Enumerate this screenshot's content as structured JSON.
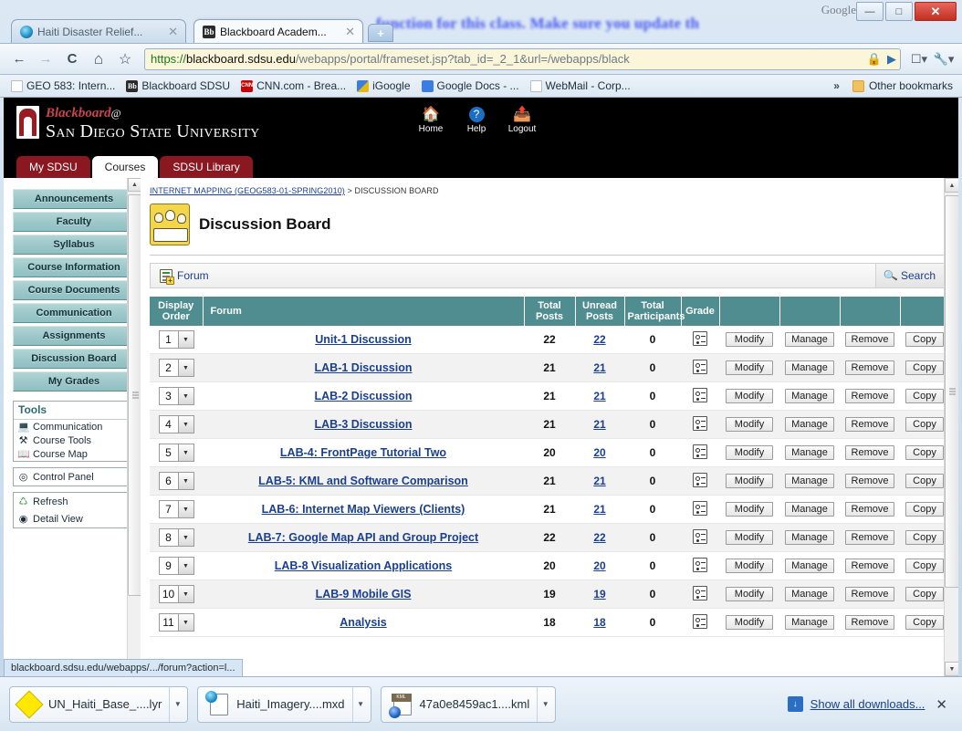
{
  "browser": {
    "ghost_text": "function for this class.  Make sure you update th",
    "google_label": "Google",
    "window_controls": {
      "minimize": "—",
      "maximize": "□",
      "close": "✕"
    },
    "tabs": [
      {
        "title": "Haiti Disaster Relief...",
        "favicon": "globe-icon",
        "active": false
      },
      {
        "title": "Blackboard Academ...",
        "favicon": "blackboard-icon",
        "active": true
      }
    ],
    "new_tab_label": "+",
    "nav": {
      "back": "←",
      "forward": "→",
      "reload": "C",
      "home": "⌂",
      "bookmark_star": "☆"
    },
    "omnibox": {
      "scheme": "https://",
      "host": "blackboard.sdsu.edu",
      "path": "/webapps/portal/frameset.jsp?tab_id=_2_1&url=/webapps/black",
      "lock_icon": "lock-icon",
      "go_icon": "▶",
      "page_menu_icon": "❐",
      "wrench_icon": "⚒"
    },
    "bookmarks": [
      {
        "label": "GEO 583:  Intern...",
        "icon": "page-icon"
      },
      {
        "label": "Blackboard SDSU",
        "icon": "blackboard-icon"
      },
      {
        "label": "CNN.com - Brea...",
        "icon": "cnn-icon"
      },
      {
        "label": "iGoogle",
        "icon": "igoogle-icon"
      },
      {
        "label": "Google Docs - ...",
        "icon": "gdocs-icon"
      },
      {
        "label": "WebMail - Corp...",
        "icon": "page-icon"
      }
    ],
    "bookmarks_overflow": "»",
    "other_bookmarks": "Other bookmarks",
    "status_tip": "blackboard.sdsu.edu/webapps/.../forum?action=l..."
  },
  "bb_header": {
    "brand_word": "Blackboard",
    "brand_at": "@",
    "brand_university": "San Diego State University",
    "utilities": [
      {
        "label": "Home",
        "icon": "home-icon",
        "glyph": "🏠"
      },
      {
        "label": "Help",
        "icon": "help-icon",
        "glyph": "?"
      },
      {
        "label": "Logout",
        "icon": "logout-icon",
        "glyph": "↪"
      }
    ],
    "tabs": [
      {
        "label": "My SDSU",
        "active": false
      },
      {
        "label": "Courses",
        "active": true
      },
      {
        "label": "SDSU Library",
        "active": false
      }
    ]
  },
  "sidebar": {
    "buttons": [
      "Announcements",
      "Faculty",
      "Syllabus",
      "Course Information",
      "Course Documents",
      "Communication",
      "Assignments",
      "Discussion Board",
      "My Grades"
    ],
    "tools_panel": {
      "title": "Tools",
      "items": [
        {
          "label": "Communication",
          "icon": "monitor-icon",
          "glyph": "▤"
        },
        {
          "label": "Course Tools",
          "icon": "tools-icon",
          "glyph": "⚒"
        },
        {
          "label": "Course Map",
          "icon": "book-icon",
          "glyph": "▥"
        }
      ]
    },
    "control_panel": {
      "label": "Control Panel",
      "icon": "control-panel-icon",
      "glyph": "◎"
    },
    "view_panel": [
      {
        "label": "Refresh",
        "icon": "refresh-icon",
        "glyph": "↻"
      },
      {
        "label": "Detail View",
        "icon": "detail-view-icon",
        "glyph": "◉"
      }
    ]
  },
  "main": {
    "breadcrumb": {
      "course": "INTERNET MAPPING (GEOG583-01-SPRING2010)",
      "separator": ">",
      "current": "DISCUSSION BOARD"
    },
    "page_title": "Discussion Board",
    "page_icon": "discussion-board-icon",
    "action_bar": {
      "forum_label": "Forum",
      "forum_icon": "add-forum-icon",
      "search_label": "Search",
      "search_icon": "magnifier-icon"
    },
    "table": {
      "headers": [
        "Display Order",
        "Forum",
        "Total Posts",
        "Unread Posts",
        "Total Participants",
        "Grade",
        "",
        "",
        "",
        ""
      ],
      "row_buttons": [
        "Modify",
        "Manage",
        "Remove",
        "Copy"
      ],
      "rows": [
        {
          "order": "1",
          "forum": "Unit-1 Discussion",
          "total_posts": "22",
          "unread_posts": "22",
          "participants": "0"
        },
        {
          "order": "2",
          "forum": "LAB-1 Discussion",
          "total_posts": "21",
          "unread_posts": "21",
          "participants": "0"
        },
        {
          "order": "3",
          "forum": "LAB-2 Discussion",
          "total_posts": "21",
          "unread_posts": "21",
          "participants": "0"
        },
        {
          "order": "4",
          "forum": "LAB-3 Discussion",
          "total_posts": "21",
          "unread_posts": "21",
          "participants": "0"
        },
        {
          "order": "5",
          "forum": "LAB-4: FrontPage Tutorial Two",
          "total_posts": "20",
          "unread_posts": "20",
          "participants": "0"
        },
        {
          "order": "6",
          "forum": "LAB-5: KML and Software Comparison",
          "total_posts": "21",
          "unread_posts": "21",
          "participants": "0"
        },
        {
          "order": "7",
          "forum": "LAB-6: Internet Map Viewers (Clients)",
          "total_posts": "21",
          "unread_posts": "21",
          "participants": "0"
        },
        {
          "order": "8",
          "forum": "LAB-7: Google Map API and Group Project",
          "total_posts": "22",
          "unread_posts": "22",
          "participants": "0"
        },
        {
          "order": "9",
          "forum": "LAB-8 Visualization Applications",
          "total_posts": "20",
          "unread_posts": "20",
          "participants": "0"
        },
        {
          "order": "10",
          "forum": "LAB-9 Mobile GIS",
          "total_posts": "19",
          "unread_posts": "19",
          "participants": "0"
        },
        {
          "order": "11",
          "forum": "Analysis",
          "total_posts": "18",
          "unread_posts": "18",
          "participants": "0"
        }
      ]
    }
  },
  "downloads": {
    "items": [
      {
        "name": "UN_Haiti_Base_....lyr",
        "icon": "layer-file-icon"
      },
      {
        "name": "Haiti_Imagery....mxd",
        "icon": "mxd-file-icon"
      },
      {
        "name": "47a0e8459ac1....kml",
        "icon": "kml-file-icon"
      }
    ],
    "show_all_label": "Show all downloads...",
    "show_all_icon": "download-icon",
    "close_icon": "✕"
  }
}
